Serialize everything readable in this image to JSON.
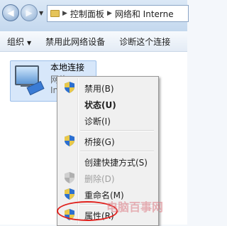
{
  "address_bar": {
    "breadcrumb": [
      "控制面板",
      "网络和 Interne"
    ]
  },
  "toolbar": {
    "items": [
      {
        "label": "组织",
        "has_dropdown": true
      },
      {
        "label": "禁用此网络设备"
      },
      {
        "label": "诊断这个连接"
      }
    ]
  },
  "connection": {
    "name": "本地连接",
    "line2": "网络",
    "line3": "Int"
  },
  "context_menu": {
    "items": [
      {
        "label": "禁用(B)",
        "icon": "uac-shield-icon"
      },
      {
        "label": "状态(U)",
        "bold": true
      },
      {
        "label": "诊断(I)"
      },
      {
        "label": "桥接(G)",
        "icon": "uac-shield-icon"
      },
      {
        "label": "创建快捷方式(S)"
      },
      {
        "label": "删除(D)",
        "icon": "uac-shield-icon",
        "disabled": true
      },
      {
        "label": "重命名(M)",
        "icon": "uac-shield-icon"
      },
      {
        "label": "属性(R)",
        "icon": "uac-shield-icon"
      }
    ]
  },
  "watermark": {
    "text": "电脑百事网"
  },
  "colors": {
    "highlight": "#e0201c",
    "selection": "#d7e7fa"
  }
}
